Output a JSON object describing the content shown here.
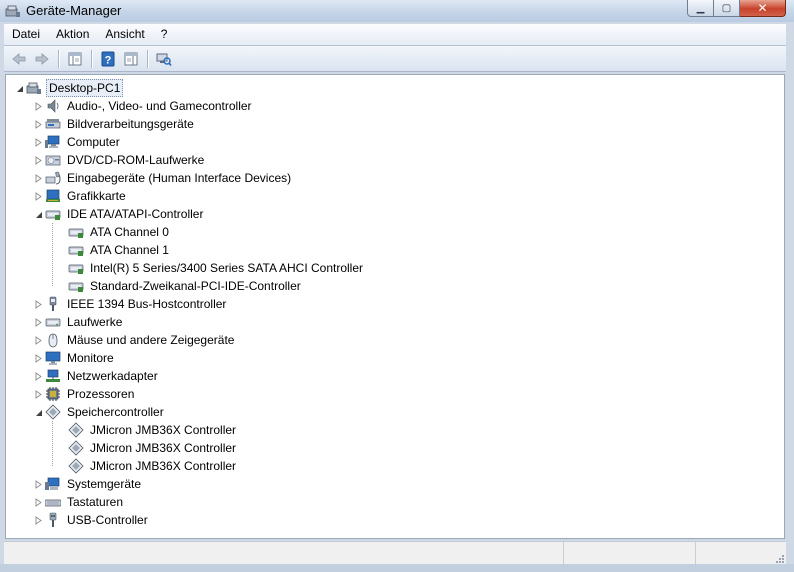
{
  "window": {
    "title": "Geräte-Manager"
  },
  "colors": {
    "accent": "#2f6fbf",
    "selection": "#e8eef7",
    "close_button": "#c7432a"
  },
  "menu": {
    "items": [
      "Datei",
      "Aktion",
      "Ansicht",
      "?"
    ]
  },
  "toolbar": {
    "buttons": [
      "back-arrow-icon",
      "forward-arrow-icon",
      "show-hide-console-tree-icon",
      "help-icon",
      "properties-panel-icon",
      "scan-hardware-icon"
    ]
  },
  "tree": {
    "root": "Desktop-PC1",
    "categories": [
      {
        "label": "Audio-, Video- und Gamecontroller",
        "icon": "speaker-icon"
      },
      {
        "label": "Bildverarbeitungsgeräte",
        "icon": "scanner-icon"
      },
      {
        "label": "Computer",
        "icon": "computer-icon"
      },
      {
        "label": "DVD/CD-ROM-Laufwerke",
        "icon": "optical-drive-icon"
      },
      {
        "label": "Eingabegeräte (Human Interface Devices)",
        "icon": "hid-icon"
      },
      {
        "label": "Grafikkarte",
        "icon": "display-adapter-icon"
      },
      {
        "label": "IDE ATA/ATAPI-Controller",
        "icon": "ide-controller-icon",
        "expanded": true,
        "children": [
          "ATA Channel 0",
          "ATA Channel 1",
          "Intel(R) 5 Series/3400 Series SATA AHCI Controller",
          "Standard-Zweikanal-PCI-IDE-Controller"
        ]
      },
      {
        "label": "IEEE 1394 Bus-Hostcontroller",
        "icon": "firewire-icon"
      },
      {
        "label": "Laufwerke",
        "icon": "disk-drive-icon"
      },
      {
        "label": "Mäuse und andere Zeigegeräte",
        "icon": "mouse-icon"
      },
      {
        "label": "Monitore",
        "icon": "monitor-icon"
      },
      {
        "label": "Netzwerkadapter",
        "icon": "network-adapter-icon"
      },
      {
        "label": "Prozessoren",
        "icon": "processor-icon"
      },
      {
        "label": "Speichercontroller",
        "icon": "storage-controller-icon",
        "expanded": true,
        "children": [
          "JMicron JMB36X Controller",
          "JMicron JMB36X Controller",
          "JMicron JMB36X Controller"
        ]
      },
      {
        "label": "Systemgeräte",
        "icon": "system-devices-icon"
      },
      {
        "label": "Tastaturen",
        "icon": "keyboard-icon"
      },
      {
        "label": "USB-Controller",
        "icon": "usb-icon"
      }
    ]
  }
}
